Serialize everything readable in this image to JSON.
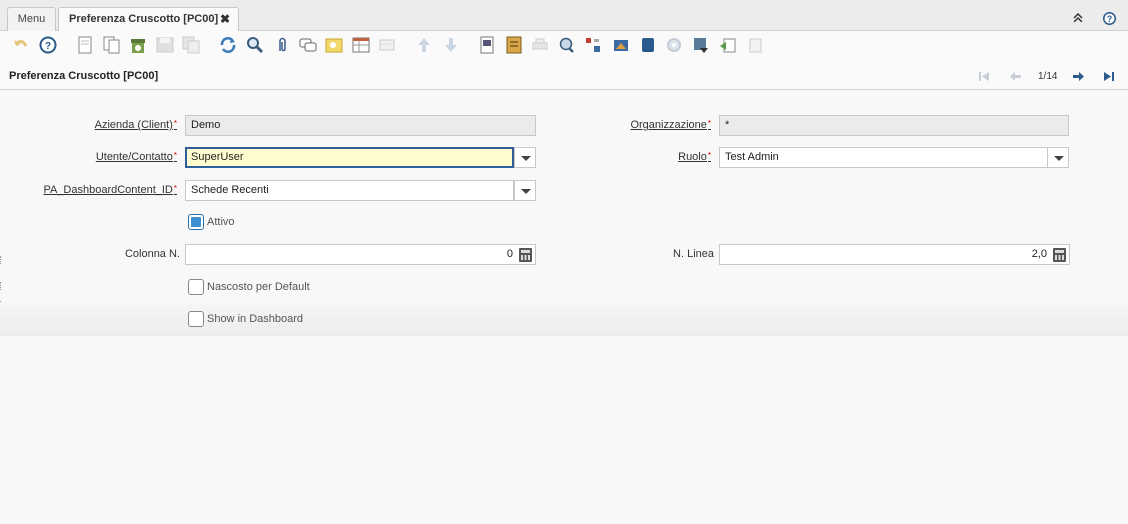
{
  "tabs": {
    "menu_label": "Menu",
    "active_label": "Preferenza Cruscotto [PC00]",
    "close_glyph": "✖"
  },
  "window_controls": {
    "collapse_glyph": "⌃",
    "help_glyph": "?"
  },
  "toolbar": {
    "icons": [
      "undo-icon",
      "help-icon",
      "new-record-icon",
      "copy-record-icon",
      "delete-icon",
      "save-icon",
      "save-new-icon",
      "refresh-icon",
      "find-icon",
      "attachment-icon",
      "chat-icon",
      "post-it-icon",
      "grid-toggle-icon",
      "multi-view-icon",
      "previous-record-arrow-icon",
      "next-record-arrow-icon",
      "report-icon",
      "archive-icon",
      "print-icon",
      "zoom-across-icon",
      "active-workflows-icon",
      "requests-icon",
      "product-info-icon",
      "process-icon",
      "customize-icon",
      "export-icon",
      "import-icon",
      "lock-icon"
    ]
  },
  "header": {
    "title": "Preferenza Cruscotto [PC00]",
    "record_count": "1/14"
  },
  "form": {
    "client": {
      "label": "Azienda (Client)",
      "value": "Demo"
    },
    "organization": {
      "label": "Organizzazione",
      "value": "*"
    },
    "user": {
      "label": "Utente/Contatto",
      "value": "SuperUser"
    },
    "role": {
      "label": "Ruolo",
      "value": "Test Admin"
    },
    "dashboard_content": {
      "label": "PA_DashboardContent_ID",
      "value": "Schede Recenti"
    },
    "active": {
      "label": "Attivo",
      "checked": true
    },
    "column_no": {
      "label": "Colonna N.",
      "value": "0"
    },
    "line_no": {
      "label": "N. Linea",
      "value": "2,0"
    },
    "hidden_default": {
      "label": "Nascosto per Default",
      "checked": false
    },
    "show_dashboard": {
      "label": "Show in Dashboard",
      "checked": false
    },
    "required_mark": "*"
  },
  "colors": {
    "accent": "#2b5a8c",
    "active_field_bg": "#fffdd0"
  }
}
